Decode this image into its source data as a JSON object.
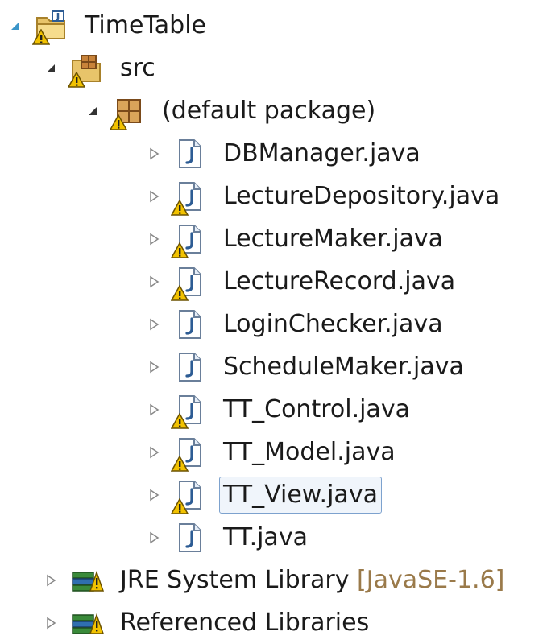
{
  "tree": {
    "project": {
      "label": "TimeTable",
      "icon": "java-project-folder-icon",
      "expanded": true
    },
    "src": {
      "label": "src",
      "icon": "source-folder-icon",
      "expanded": true
    },
    "package": {
      "label": "(default package)",
      "icon": "package-icon",
      "expanded": true
    },
    "files": [
      {
        "label": "DBManager.java",
        "icon": "java-file-icon",
        "warning": false
      },
      {
        "label": "LectureDepository.java",
        "icon": "java-file-icon",
        "warning": true
      },
      {
        "label": "LectureMaker.java",
        "icon": "java-file-icon",
        "warning": true
      },
      {
        "label": "LectureRecord.java",
        "icon": "java-file-icon",
        "warning": true
      },
      {
        "label": "LoginChecker.java",
        "icon": "java-file-icon",
        "warning": false
      },
      {
        "label": "ScheduleMaker.java",
        "icon": "java-file-icon",
        "warning": false
      },
      {
        "label": "TT_Control.java",
        "icon": "java-file-icon",
        "warning": true
      },
      {
        "label": "TT_Model.java",
        "icon": "java-file-icon",
        "warning": true
      },
      {
        "label": "TT_View.java",
        "icon": "java-file-icon",
        "warning": true,
        "selected": true
      },
      {
        "label": "TT.java",
        "icon": "java-file-icon",
        "warning": false
      }
    ],
    "jre": {
      "label": "JRE System Library",
      "suffix": "[JavaSE-1.6]",
      "icon": "library-icon"
    },
    "refs": {
      "label": "Referenced Libraries",
      "icon": "library-icon"
    }
  },
  "colors": {
    "selection_border": "#7da2ce",
    "selection_fill": "#f0f5fb",
    "warning": "#f2c200",
    "java_icon_blue": "#2d5c94",
    "suffix": "#9a7a4a"
  }
}
